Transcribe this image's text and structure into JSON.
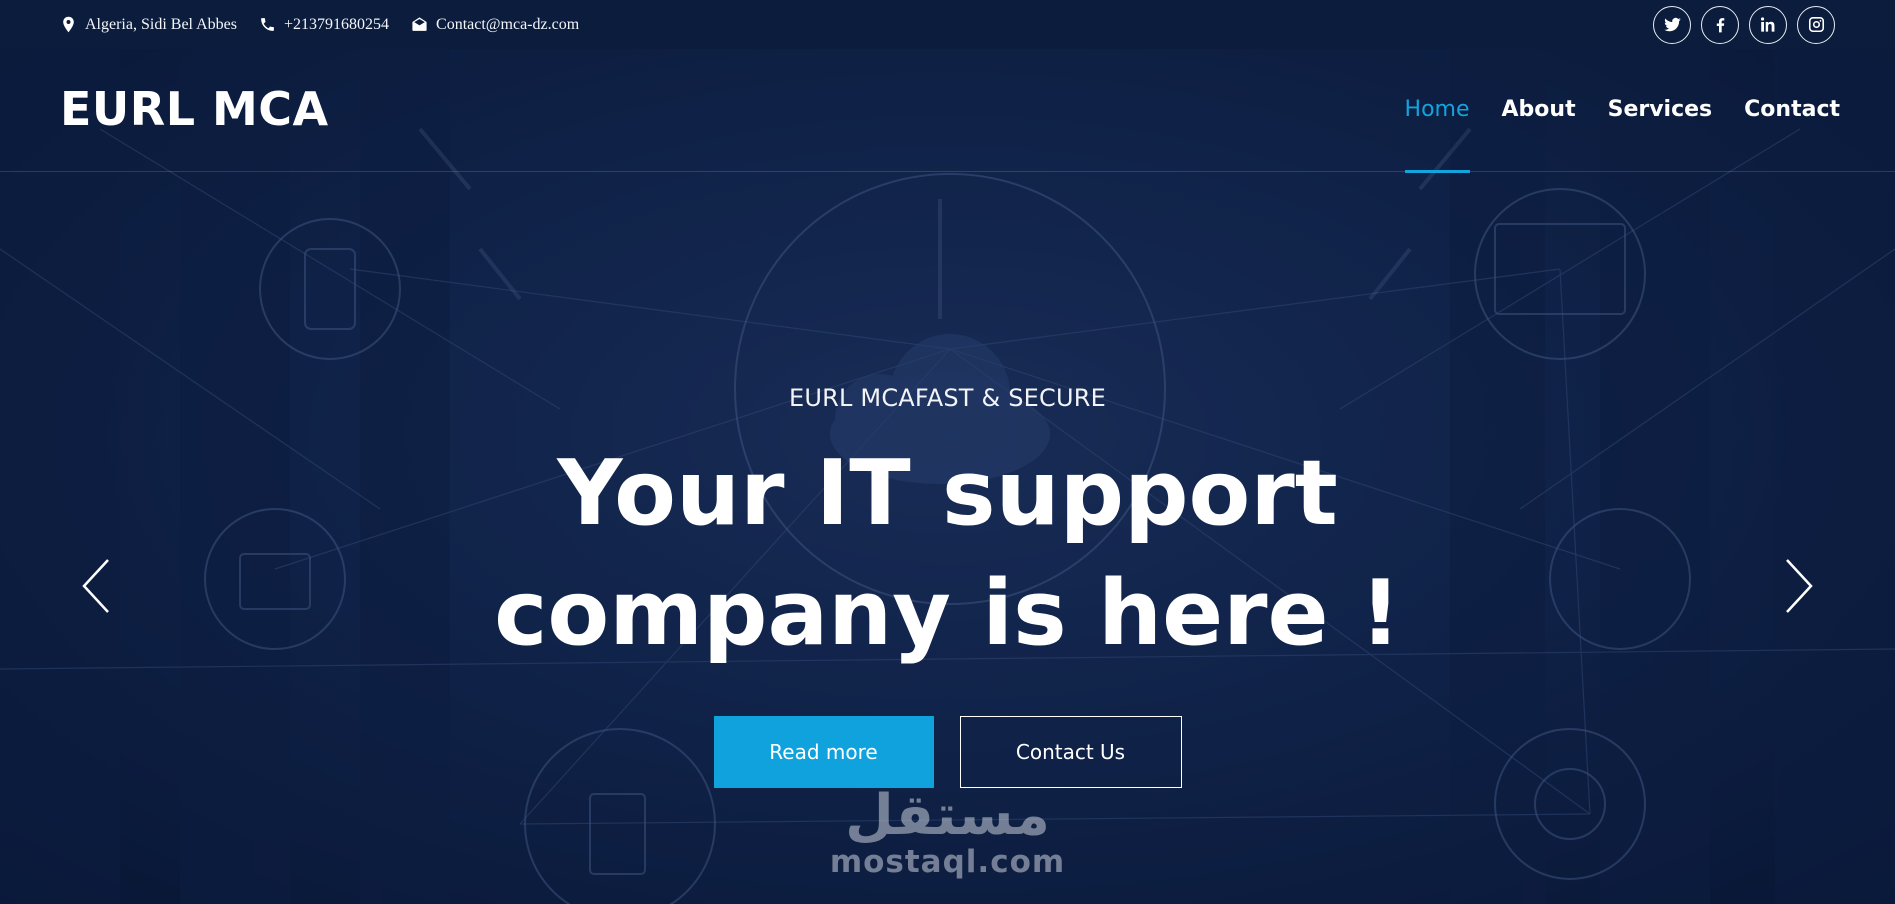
{
  "topbar": {
    "location": "Algeria, Sidi Bel Abbes",
    "phone": "+213791680254",
    "email": "Contact@mca-dz.com",
    "location_icon": "map-pin-icon",
    "phone_icon": "phone-icon",
    "email_icon": "envelope-icon",
    "socials": [
      "twitter-icon",
      "facebook-icon",
      "linkedin-icon",
      "instagram-icon"
    ]
  },
  "navbar": {
    "logo": "EURL MCA",
    "links": [
      "Home",
      "About",
      "Services",
      "Contact"
    ],
    "active": "Home"
  },
  "hero": {
    "tagline": "EURL MCAFAST & SECURE",
    "headline_line1": "Your IT support",
    "headline_line2": "company is here !",
    "primary_button": "Read more",
    "secondary_button": "Contact Us",
    "prev_icon": "chevron-left-icon",
    "next_icon": "chevron-right-icon"
  },
  "watermark": {
    "glyph": "مستقل",
    "text": "mostaql.com"
  },
  "colors": {
    "accent": "#0fa2dc",
    "topbar_bg": "#0b1c3c",
    "hero_bg": "#132851"
  }
}
